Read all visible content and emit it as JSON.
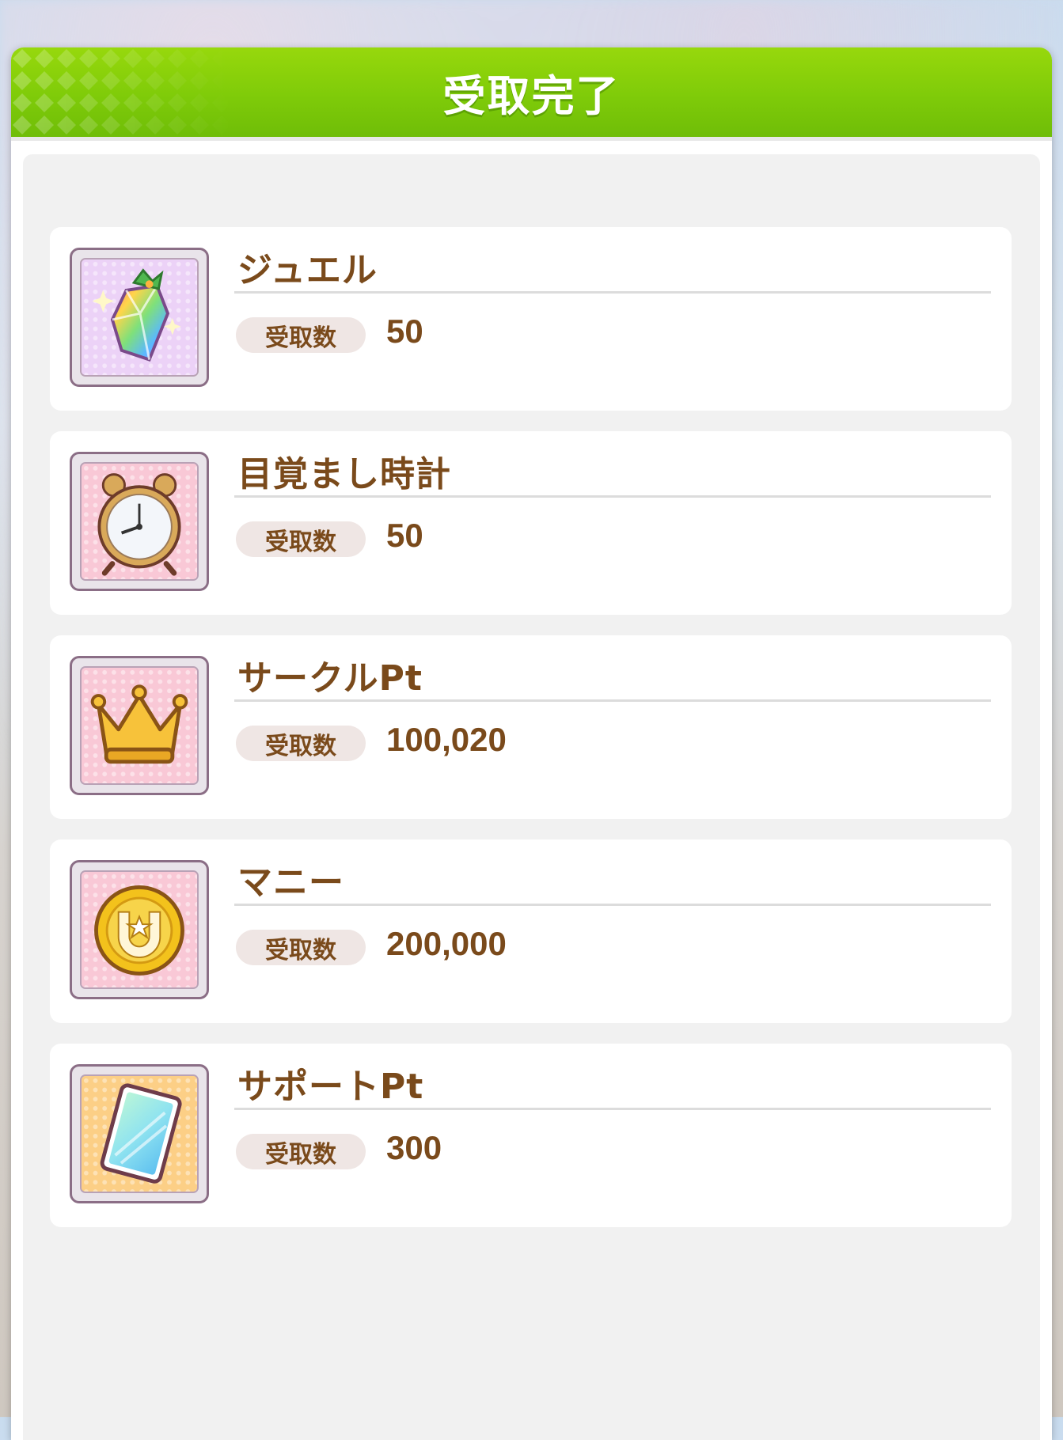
{
  "dialog": {
    "title": "受取完了",
    "header_color": "#86cf0a"
  },
  "quantity_label": "受取数",
  "items": [
    {
      "name": "ジュエル",
      "quantity": "50",
      "icon": "jewel-icon",
      "bg_color": "#e6c9f3"
    },
    {
      "name": "目覚まし時計",
      "quantity": "50",
      "icon": "alarm-clock-icon",
      "bg_color": "#f8c9d6"
    },
    {
      "name": "サークルPt",
      "quantity": "100,020",
      "icon": "crown-icon",
      "bg_color": "#f8c9d6"
    },
    {
      "name": "マニー",
      "quantity": "200,000",
      "icon": "coin-icon",
      "bg_color": "#f8c9d6"
    },
    {
      "name": "サポートPt",
      "quantity": "300",
      "icon": "support-card-icon",
      "bg_color": "#fbcf86"
    }
  ]
}
